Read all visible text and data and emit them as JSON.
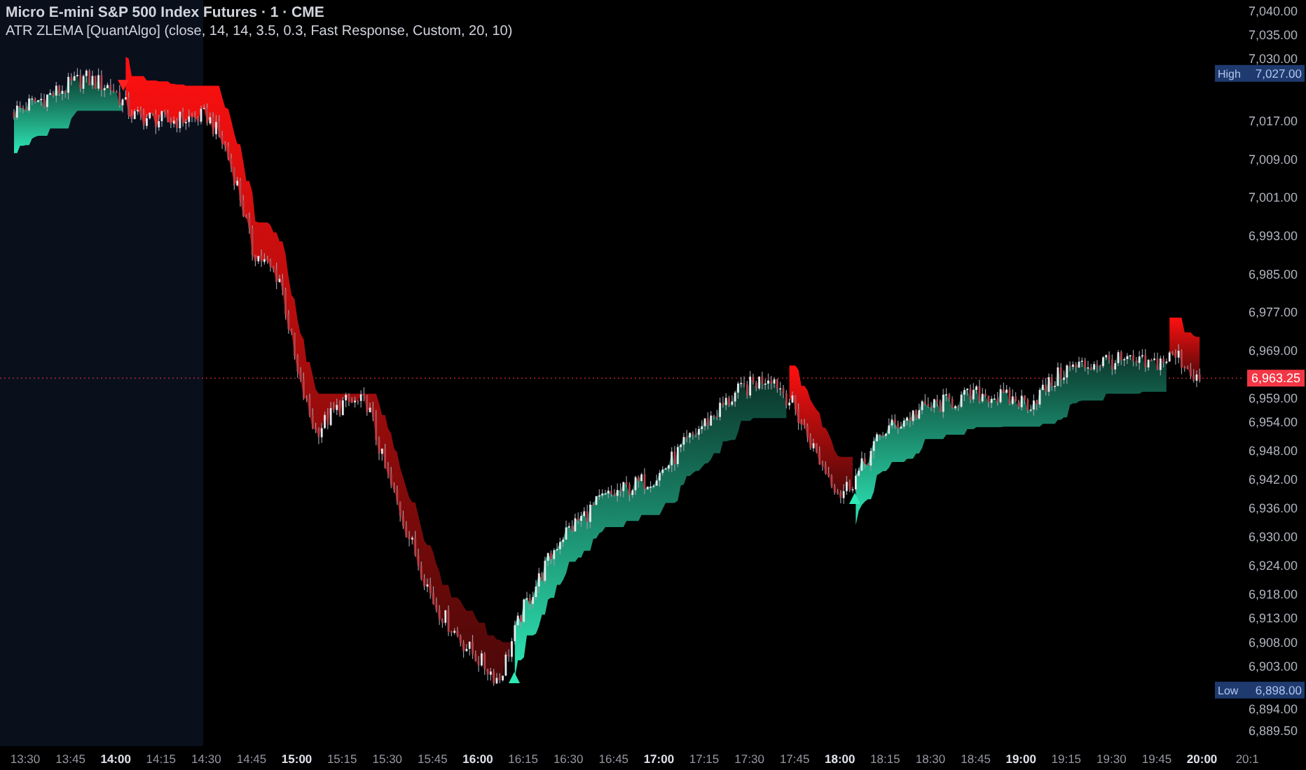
{
  "legend": {
    "symbol": "Micro E-mini S&P 500 Index Futures · 1 · CME",
    "indicator": "ATR ZLEMA [QuantAlgo] (close, 14, 14, 3.5, 0.3, Fast Response, Custom, 20, 10)"
  },
  "price_axis": [
    {
      "kind": "tick",
      "value": "7,040.00"
    },
    {
      "kind": "tick",
      "value": "7,035.00"
    },
    {
      "kind": "tick",
      "value": "7,030.00"
    },
    {
      "kind": "high",
      "tag": "High",
      "value": "7,027.00"
    },
    {
      "kind": "tick",
      "value": "7,017.00"
    },
    {
      "kind": "tick",
      "value": "7,009.00"
    },
    {
      "kind": "tick",
      "value": "7,001.00"
    },
    {
      "kind": "tick",
      "value": "6,993.00"
    },
    {
      "kind": "tick",
      "value": "6,985.00"
    },
    {
      "kind": "tick",
      "value": "6,977.00"
    },
    {
      "kind": "tick",
      "value": "6,969.00"
    },
    {
      "kind": "last",
      "value": "6,963.25"
    },
    {
      "kind": "tick",
      "value": "6,959.00"
    },
    {
      "kind": "tick",
      "value": "6,954.00"
    },
    {
      "kind": "tick",
      "value": "6,948.00"
    },
    {
      "kind": "tick",
      "value": "6,942.00"
    },
    {
      "kind": "tick",
      "value": "6,936.00"
    },
    {
      "kind": "tick",
      "value": "6,930.00"
    },
    {
      "kind": "tick",
      "value": "6,924.00"
    },
    {
      "kind": "tick",
      "value": "6,918.00"
    },
    {
      "kind": "tick",
      "value": "6,913.00"
    },
    {
      "kind": "tick",
      "value": "6,908.00"
    },
    {
      "kind": "tick",
      "value": "6,903.00"
    },
    {
      "kind": "low",
      "tag": "Low",
      "value": "6,898.00"
    },
    {
      "kind": "tick",
      "value": "6,894.00"
    },
    {
      "kind": "tick",
      "value": "6,889.50"
    }
  ],
  "time_axis": [
    {
      "label": "13:30",
      "major": false
    },
    {
      "label": "13:45",
      "major": false
    },
    {
      "label": "14:00",
      "major": true
    },
    {
      "label": "14:15",
      "major": false
    },
    {
      "label": "14:30",
      "major": false
    },
    {
      "label": "14:45",
      "major": false
    },
    {
      "label": "15:00",
      "major": true
    },
    {
      "label": "15:15",
      "major": false
    },
    {
      "label": "15:30",
      "major": false
    },
    {
      "label": "15:45",
      "major": false
    },
    {
      "label": "16:00",
      "major": true
    },
    {
      "label": "16:15",
      "major": false
    },
    {
      "label": "16:30",
      "major": false
    },
    {
      "label": "16:45",
      "major": false
    },
    {
      "label": "17:00",
      "major": true
    },
    {
      "label": "17:15",
      "major": false
    },
    {
      "label": "17:30",
      "major": false
    },
    {
      "label": "17:45",
      "major": false
    },
    {
      "label": "18:00",
      "major": true
    },
    {
      "label": "18:15",
      "major": false
    },
    {
      "label": "18:30",
      "major": false
    },
    {
      "label": "18:45",
      "major": false
    },
    {
      "label": "19:00",
      "major": true
    },
    {
      "label": "19:15",
      "major": false
    },
    {
      "label": "19:30",
      "major": false
    },
    {
      "label": "19:45",
      "major": false
    },
    {
      "label": "20:00",
      "major": true
    },
    {
      "label": "20:1",
      "major": false
    }
  ]
}
